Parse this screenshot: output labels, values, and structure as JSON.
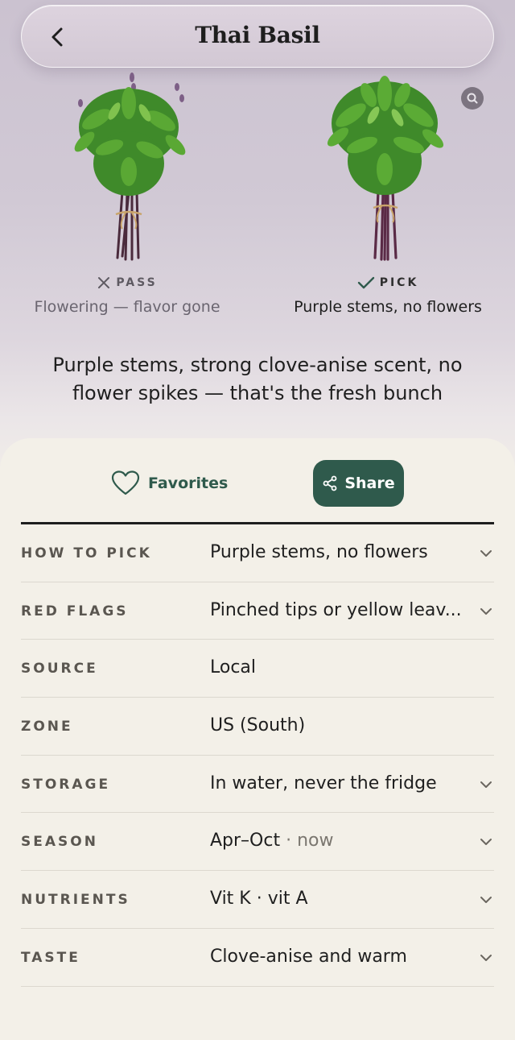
{
  "header": {
    "title": "Thai Basil"
  },
  "comparison": {
    "pass": {
      "tag": "PASS",
      "caption": "Flowering — flavor gone"
    },
    "pick": {
      "tag": "PICK",
      "caption": "Purple stems, no flowers"
    }
  },
  "summary": "Purple stems, strong clove-anise scent, no flower spikes — that's the fresh bunch",
  "actions": {
    "favorites_label": "Favorites",
    "share_label": "Share"
  },
  "colors": {
    "accent": "#2f5a4c",
    "background_top": "#cbc2d0",
    "sheet": "#f3f0e8"
  },
  "details": [
    {
      "label": "HOW TO PICK",
      "value": "Purple stems, no flowers",
      "value_note": "",
      "expandable": true
    },
    {
      "label": "RED FLAGS",
      "value": "Pinched tips or yellow leav...",
      "value_note": "",
      "expandable": true
    },
    {
      "label": "SOURCE",
      "value": "Local",
      "value_note": "",
      "expandable": false
    },
    {
      "label": "ZONE",
      "value": "US (South)",
      "value_note": "",
      "expandable": false
    },
    {
      "label": "STORAGE",
      "value": "In water, never the fridge",
      "value_note": "",
      "expandable": true
    },
    {
      "label": "SEASON",
      "value": "Apr–Oct",
      "value_note": " · now",
      "expandable": true
    },
    {
      "label": "NUTRIENTS",
      "value": "Vit K · vit A",
      "value_note": "",
      "expandable": true
    },
    {
      "label": "TASTE",
      "value": "Clove-anise and warm",
      "value_note": "",
      "expandable": true
    }
  ]
}
